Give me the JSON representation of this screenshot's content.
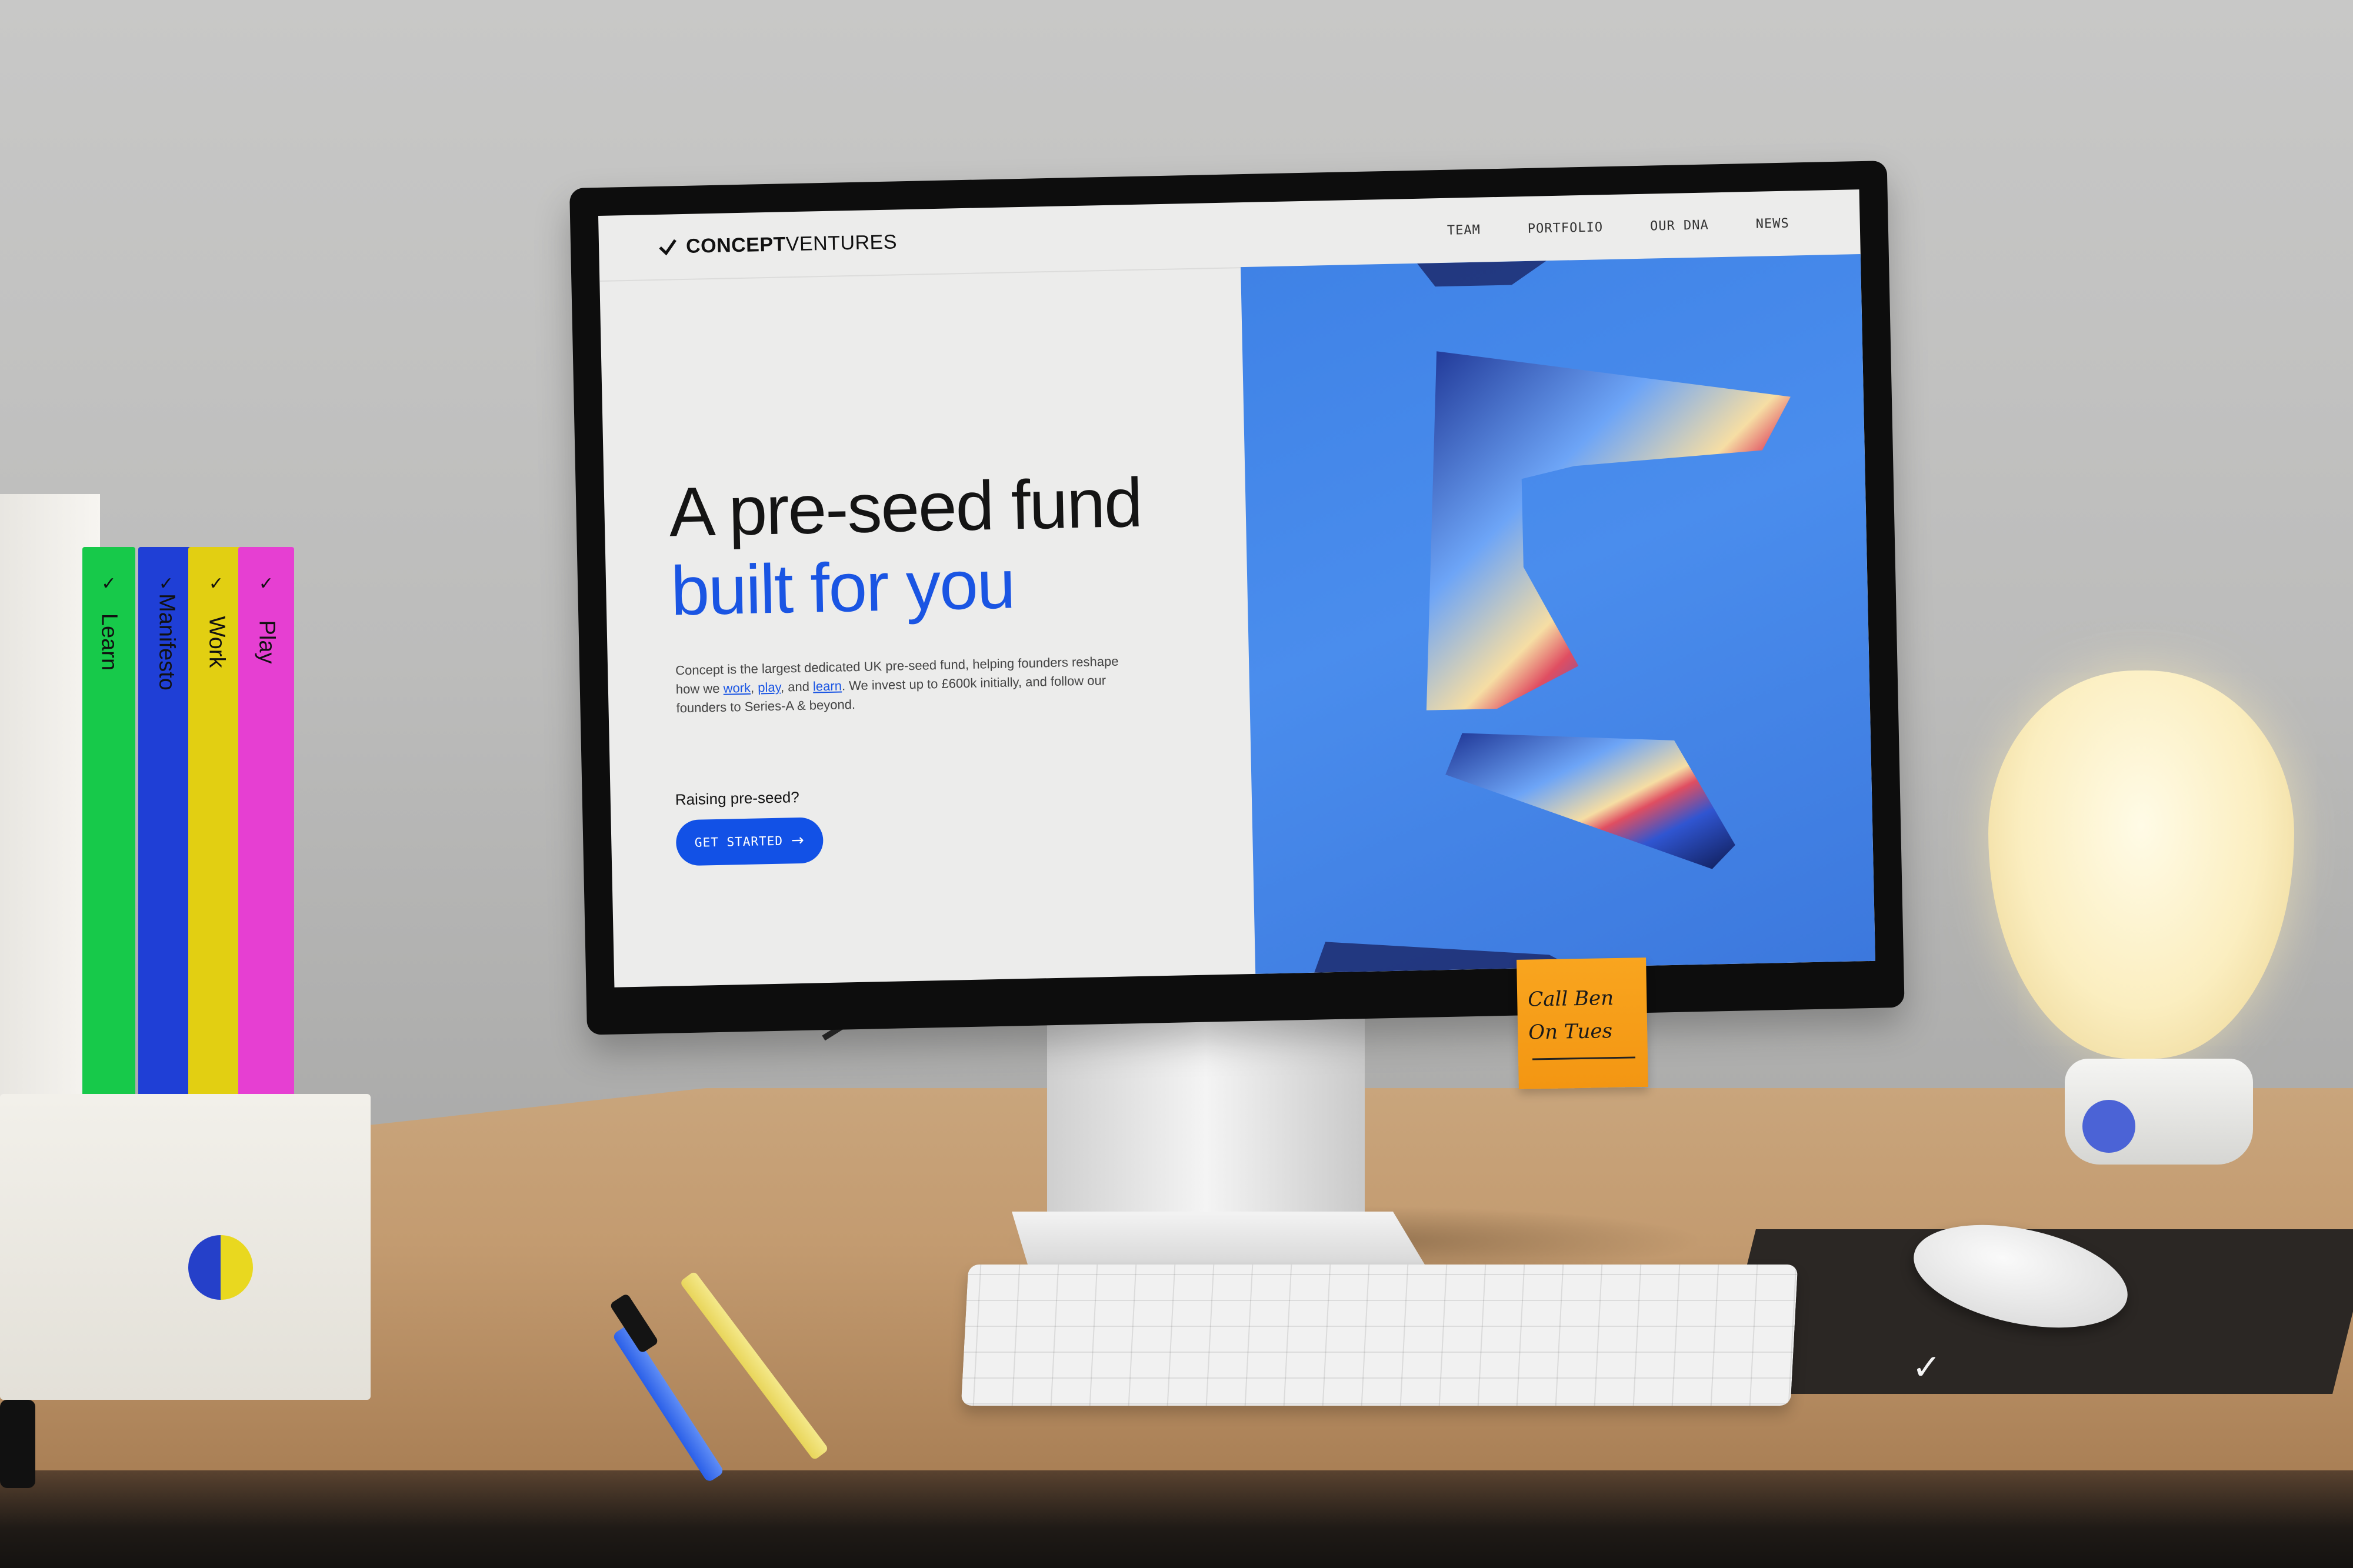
{
  "site": {
    "brand": {
      "bold": "CONCEPT",
      "light": "VENTURES"
    },
    "nav": [
      {
        "label": "TEAM"
      },
      {
        "label": "PORTFOLIO"
      },
      {
        "label": "OUR DNA"
      },
      {
        "label": "NEWS"
      }
    ],
    "hero": {
      "headline_line1": "A pre-seed fund",
      "headline_line2": "built for you",
      "intro_part1": "Concept is the largest dedicated UK pre-seed fund, helping founders reshape how we ",
      "link_work": "work",
      "sep1": ", ",
      "link_play": "play",
      "sep2": ", and ",
      "link_learn": "learn",
      "intro_part2": ". We invest up to £600k initially, and follow our founders to Series-A & beyond.",
      "raising": "Raising pre-seed?",
      "cta_label": "GET STARTED",
      "cta_arrow": "→"
    }
  },
  "magazines": [
    {
      "label": "Learn",
      "color": "#17c94a"
    },
    {
      "label": "Manifesto",
      "color": "#1f3fd6"
    },
    {
      "label": "Work",
      "color": "#e2cf12"
    },
    {
      "label": "Play",
      "color": "#e63fd2"
    }
  ],
  "sticky_note": {
    "line1": "Call Ben",
    "line2": "On Tues"
  },
  "colors": {
    "accent": "#1a55e3",
    "hero_bg": "#4a8ded"
  }
}
